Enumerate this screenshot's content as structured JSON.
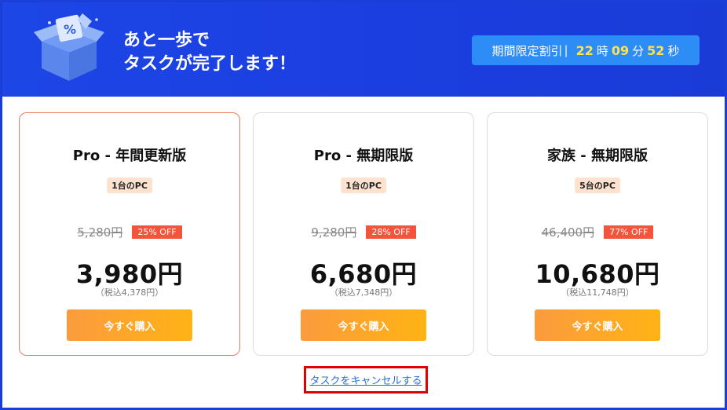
{
  "header": {
    "title_line1": "あと一歩で",
    "title_line2": "タスクが完了します！",
    "icon": "discount-box-icon"
  },
  "timer": {
    "label": "期間限定割引",
    "separator": "|",
    "hours": "22",
    "hours_unit": "時",
    "minutes": "09",
    "minutes_unit": "分",
    "seconds": "52",
    "seconds_unit": "秒"
  },
  "plans": [
    {
      "title": "Pro - 年間更新版",
      "pcs": "1台のPC",
      "old_price": "5,280円",
      "discount": "25% OFF",
      "price": "3,980円",
      "tax_note": "（税込4,378円）",
      "button": "今すぐ購入"
    },
    {
      "title": "Pro - 無期限版",
      "pcs": "1台のPC",
      "old_price": "9,280円",
      "discount": "28% OFF",
      "price": "6,680円",
      "tax_note": "（税込7,348円）",
      "button": "今すぐ購入"
    },
    {
      "title": "家族 - 無期限版",
      "pcs": "5台のPC",
      "old_price": "46,400円",
      "discount": "77% OFF",
      "price": "10,680円",
      "tax_note": "（税込11,748円）",
      "button": "今すぐ購入"
    }
  ],
  "cancel_link": "タスクをキャンセルする",
  "colors": {
    "header_bg": "#1d46e6",
    "timer_bg": "#2e8cf7",
    "timer_digits": "#ffe347",
    "discount_badge": "#f2553b",
    "button": "#ffa928",
    "highlight_border": "#f07a5a",
    "cancel_outline": "#e00000"
  }
}
